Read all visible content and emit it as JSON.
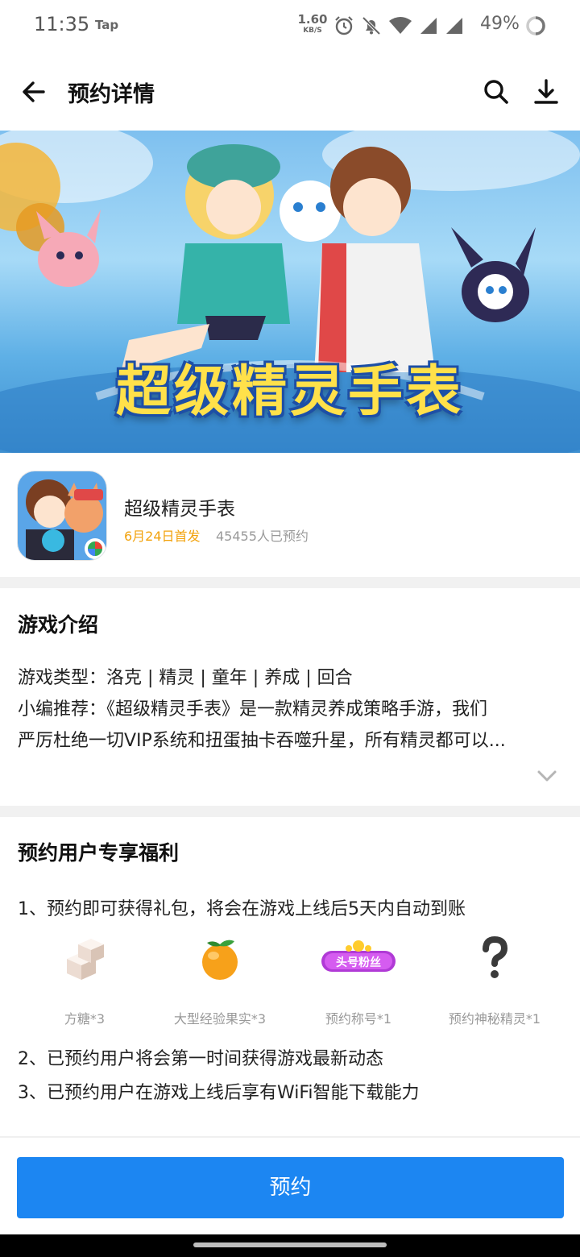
{
  "status_bar": {
    "time": "11:35",
    "app_label": "Tap",
    "net_speed_value": "1.60",
    "net_speed_unit": "KB/S",
    "battery": "49%",
    "icons": [
      "alarm-icon",
      "bell-off-icon",
      "wifi-icon",
      "signal-icon",
      "signal-icon",
      "battery-ring-icon"
    ]
  },
  "nav": {
    "title": "预约详情",
    "icons": [
      "back-arrow-icon",
      "search-icon",
      "download-icon"
    ]
  },
  "banner": {
    "title_art": "超级精灵手表"
  },
  "app": {
    "name": "超级精灵手表",
    "release": "6月24日首发",
    "reservations": "45455人已预约"
  },
  "intro": {
    "heading": "游戏介绍",
    "lines": [
      "游戏类型：洛克 | 精灵 | 童年 | 养成 | 回合",
      "小编推荐：《超级精灵手表》是一款精灵养成策略手游，我们",
      "严厉杜绝一切VIP系统和扭蛋抽卡吞噬升星，所有精灵都可以..."
    ]
  },
  "benefits": {
    "heading": "预约用户专享福利",
    "item1": "1、预约即可获得礼包，将会在游戏上线后5天内自动到账",
    "gifts": [
      {
        "label": "方糖*3",
        "icon": "sugar-cube-icon"
      },
      {
        "label": "大型经验果实*3",
        "icon": "orange-fruit-icon"
      },
      {
        "label": "预约称号*1",
        "icon": "title-badge-icon",
        "badge_text": "头号粉丝"
      },
      {
        "label": "预约神秘精灵*1",
        "icon": "question-mark-icon"
      }
    ],
    "item2": "2、已预约用户将会第一时间获得游戏最新动态",
    "item3": "3、已预约用户在游戏上线后享有WiFi智能下载能力"
  },
  "cta": {
    "label": "预约"
  },
  "colors": {
    "primary": "#1c86f2",
    "release_date": "#f2a20c",
    "muted_text": "#999999",
    "divider": "#f1f1f1"
  }
}
